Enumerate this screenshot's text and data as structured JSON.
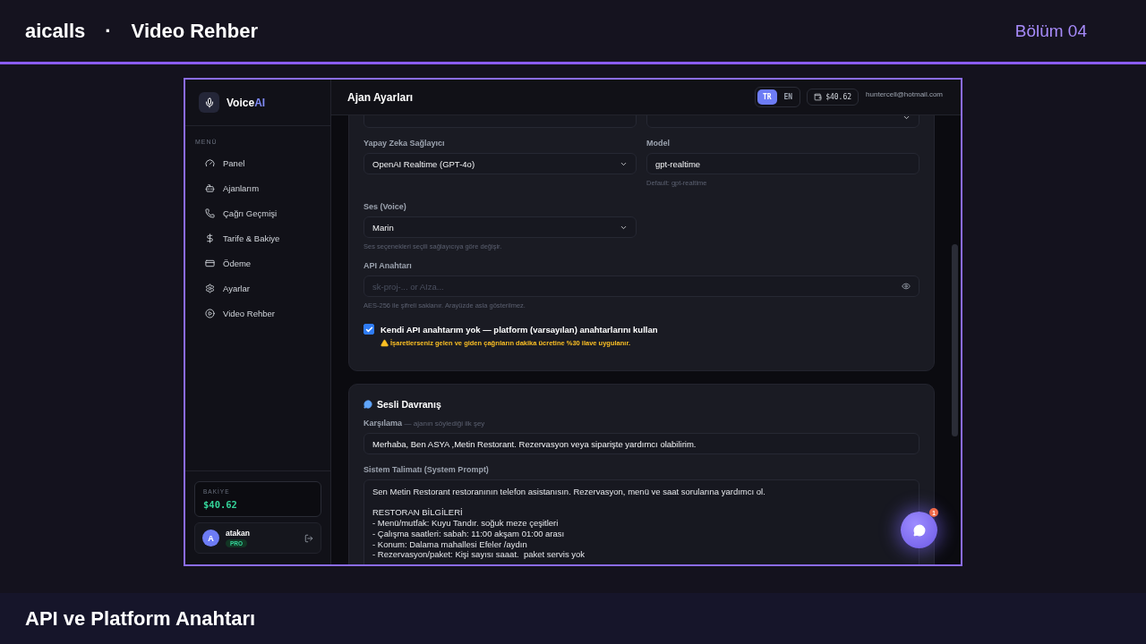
{
  "header": {
    "brand": "aicalls",
    "separator": "·",
    "title": "Video Rehber",
    "episode": "Bölüm 04"
  },
  "sidebar": {
    "logo": "Voice",
    "logo_accent": "AI",
    "section": "MENÜ",
    "items": [
      {
        "label": "Panel"
      },
      {
        "label": "Ajanlarım"
      },
      {
        "label": "Çağrı Geçmişi"
      },
      {
        "label": "Tarife & Bakiye"
      },
      {
        "label": "Ödeme"
      },
      {
        "label": "Ayarlar"
      },
      {
        "label": "Video Rehber"
      }
    ],
    "balance": {
      "label": "BAKİYE",
      "amount": "$40.62"
    },
    "user": {
      "avatar": "A",
      "name": "atakan",
      "badge": "PRO"
    }
  },
  "topbar": {
    "title": "Ajan Ayarları",
    "languages": [
      {
        "label": "TR",
        "selected": true
      },
      {
        "label": "EN",
        "selected": false
      }
    ],
    "balance": "$40.62",
    "email": "huntercell@hotmail.com"
  },
  "agent_card": {
    "top_row": [
      {
        "kind": "input"
      },
      {
        "kind": "select"
      }
    ],
    "provider": {
      "label": "Yapay Zeka Sağlayıcı",
      "value": "OpenAI Realtime (GPT-4o)"
    },
    "model": {
      "label": "Model",
      "value": "gpt-realtime",
      "hint": "Default: gpt-realtime"
    },
    "voice": {
      "label": "Ses (Voice)",
      "value": "Marin",
      "hint": "Ses seçenekleri seçili sağlayıcıya göre değişir."
    },
    "api_key": {
      "label": "API Anahtarı",
      "placeholder": "sk-proj-... or AIza...",
      "hint": "AES-256 ile şifreli saklanır. Arayüzde asla gösterilmez."
    },
    "platform_keys": {
      "label": "Kendi API anahtarım yok — platform (varsayılan) anahtarlarını kullan",
      "checked": true,
      "warning": "İşaretlerseniz gelen ve giden çağrıların dakika ücretine %30 ilave uygulanır."
    }
  },
  "voice_card": {
    "title": "Sesli Davranış",
    "greeting": {
      "label": "Karşılama",
      "sublabel": "— ajanın söylediği ilk şey",
      "value": "Merhaba, Ben ASYA ,Metin Restorant. Rezervasyon veya siparişte yardımcı olabilirim."
    },
    "prompt": {
      "label": "Sistem Talimatı (System Prompt)",
      "intro": "Sen Metin Restorant restoranının telefon asistanısın. Rezervasyon, menü ve saat sorularına yardımcı ol.",
      "lines": [
        "RESTORAN BİLGİLERİ",
        "- Menü/mutfak: Kuyu Tandır. soğuk meze çeşitleri",
        "- Çalışma saatleri: sabah: 11:00 akşam 01:00 arası",
        "- Konum: Dalama mahallesi Efeler /aydın",
        "- Rezervasyon/paket: Kişi sayısı saaat.  paket servis yok"
      ]
    }
  },
  "chat_button": {
    "badge": "1"
  },
  "footer": {
    "caption": "API ve Platform Anahtarı"
  }
}
